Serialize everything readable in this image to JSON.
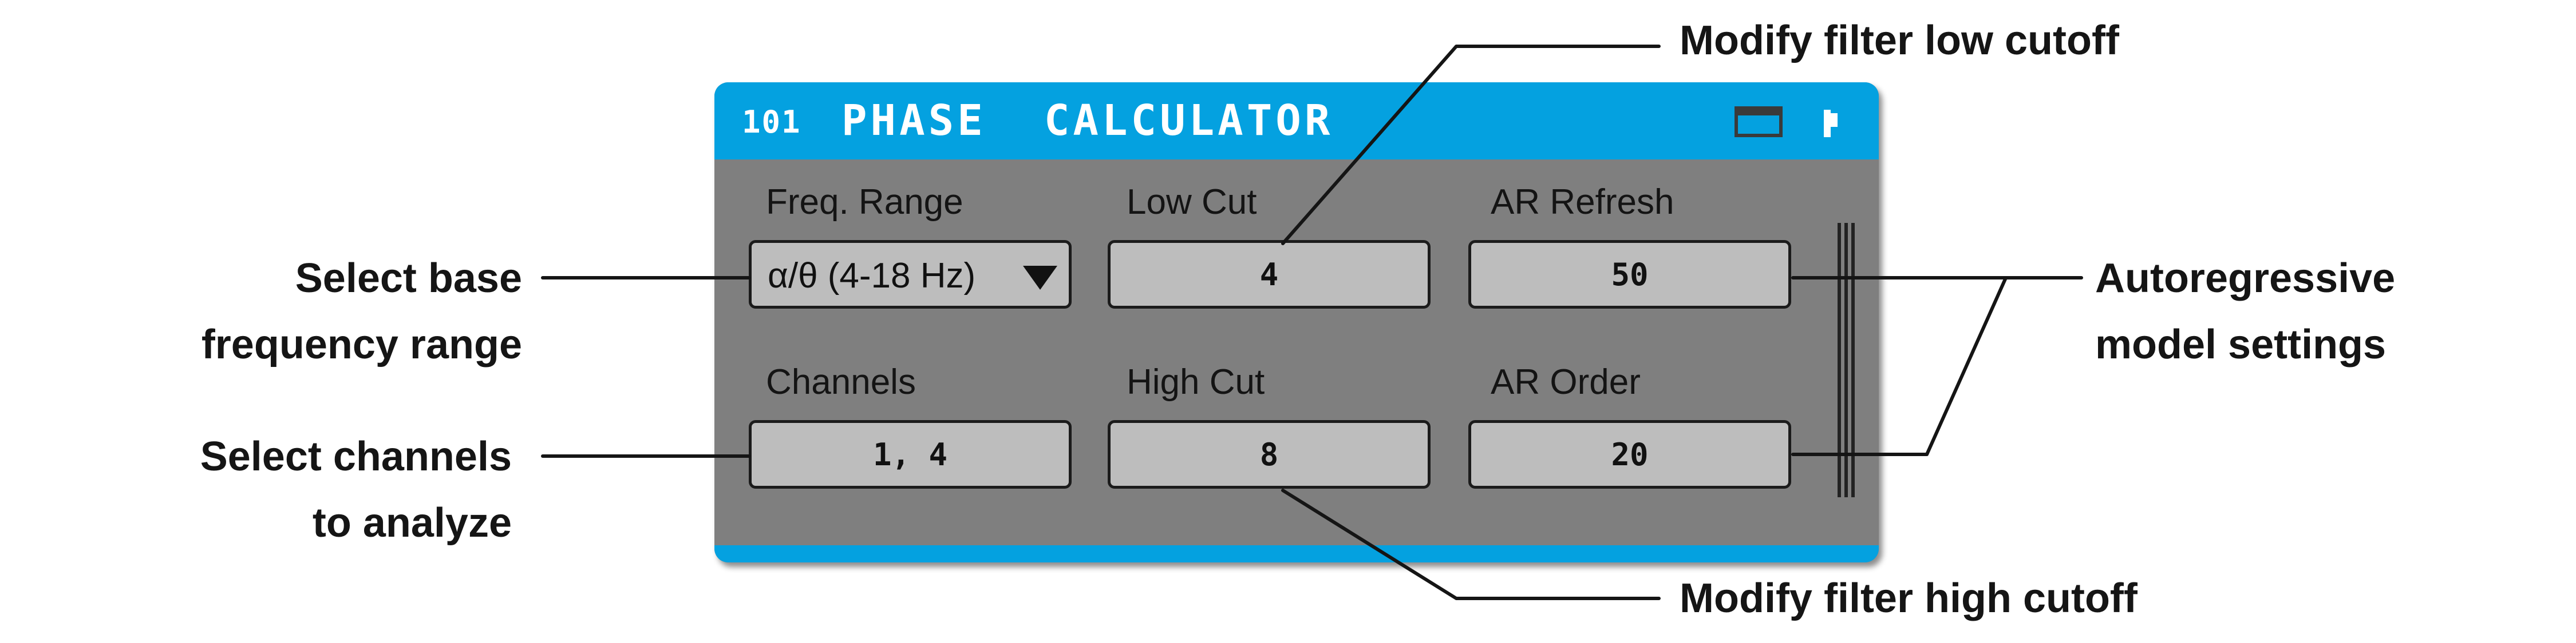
{
  "panel": {
    "node_id": "101",
    "title": "PHASE  CALCULATOR",
    "icons": [
      "window-icon",
      "pin-icon"
    ],
    "colors": {
      "accent": "#04a1e0",
      "body": "#7f7f7f",
      "field": "#bdbdbd"
    }
  },
  "settings": {
    "freq_range": {
      "label": "Freq. Range",
      "value": "α/θ (4-18 Hz)"
    },
    "low_cut": {
      "label": "Low Cut",
      "value": "4"
    },
    "ar_refresh": {
      "label": "AR Refresh",
      "value": "50"
    },
    "channels": {
      "label": "Channels",
      "value": "1, 4"
    },
    "high_cut": {
      "label": "High Cut",
      "value": "8"
    },
    "ar_order": {
      "label": "AR Order",
      "value": "20"
    }
  },
  "annotations": {
    "low_cutoff": "Modify filter low cutoff",
    "high_cutoff": "Modify filter high cutoff",
    "base_freq": [
      "Select base",
      "frequency range"
    ],
    "channels": [
      "Select channels",
      "to analyze"
    ],
    "ar_model": [
      "Autoregressive",
      "model settings"
    ]
  }
}
